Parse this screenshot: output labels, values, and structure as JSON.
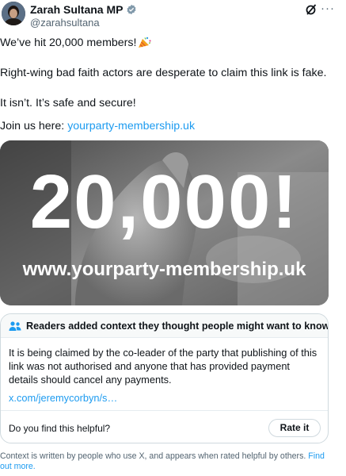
{
  "author": {
    "display_name": "Zarah Sultana MP",
    "handle": "@zarahsultana"
  },
  "icons": {
    "avatar": "profile-photo",
    "verified": "verified-badge-icon",
    "grok": "grok-icon",
    "more": "more-icon"
  },
  "post": {
    "line1": "We’ve hit 20,000 members!",
    "line1_emoji": "party-popper",
    "line2": "Right-wing bad faith actors are desperate to claim this link is fake.",
    "line3": "It isn’t. It’s safe and secure!",
    "line4_prefix": "Join us here: ",
    "line4_link": "yourparty-membership.uk"
  },
  "media": {
    "headline": "20,000!",
    "url_text": "www.yourparty-membership.uk"
  },
  "community_note": {
    "title": "Readers added context they thought people might want to know",
    "body": "It is being claimed by the co-leader of the party that publishing of this link was not authorised and anyone that has provided payment details should cancel any payments.",
    "link": "x.com/jeremycorbyn/s…",
    "helpful_question": "Do you find this helpful?",
    "rate_button": "Rate it"
  },
  "footer": {
    "text": "Context is written by people who use X, and appears when rated helpful by others.",
    "find_out_more": "Find out more."
  },
  "colors": {
    "link": "#1d9bf0",
    "verified": "#1d9bf0",
    "text": "#0f1419",
    "secondary": "#536471"
  }
}
